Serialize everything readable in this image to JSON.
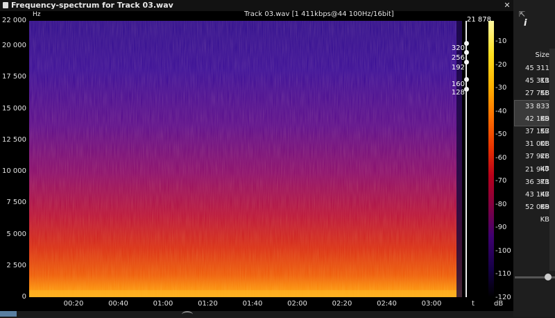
{
  "window": {
    "title": "Frequency-spectrum for Track 03.wav",
    "close_glyph": "✕"
  },
  "spectrogram": {
    "axis_y_unit": "Hz",
    "info": "Track 03.wav [1 411kbps@44 100Hz/16bit]",
    "max_frequency": "21 878",
    "y_ticks": [
      "22 000",
      "20 000",
      "17 500",
      "15 000",
      "12 500",
      "10 000",
      "7 500",
      "5 000",
      "2 500",
      "0"
    ],
    "x_ticks": [
      "00:20",
      "00:40",
      "01:00",
      "01:20",
      "01:40",
      "02:00",
      "02:20",
      "02:40",
      "03:00"
    ],
    "x_axis_label": "t",
    "bitrate_markers": [
      "320",
      "256",
      "192",
      "160",
      "128"
    ],
    "db_ticks": [
      "-10",
      "-20",
      "-30",
      "-40",
      "-50",
      "-60",
      "-70",
      "-80",
      "-90",
      "-100",
      "-110",
      "-120"
    ],
    "db_label": "dB"
  },
  "side_panel": {
    "info_icon": "i",
    "expand_icon": "⇱",
    "size_header": "Size",
    "sizes": [
      "45 311 KB",
      "45 311 KB",
      "27 758 KB",
      "33 833 KB",
      "42 189 KB",
      "37 157 KB",
      "31 008 KB",
      "37 928 KB",
      "21 947 KB",
      "36 371 KB",
      "43 147 KB",
      "52 089 KB"
    ],
    "selected_index": 3
  },
  "bottom_bar": {
    "tab_label": "tor"
  }
}
